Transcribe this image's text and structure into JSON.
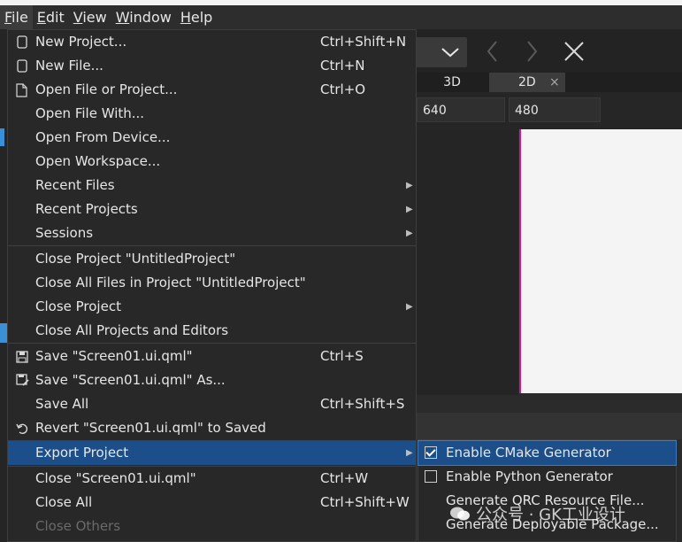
{
  "menubar": {
    "items": [
      {
        "label": "File",
        "underline": "F",
        "rest": "ile"
      },
      {
        "label": "Edit",
        "underline": "E",
        "rest": "dit"
      },
      {
        "label": "View",
        "underline": "V",
        "rest": "iew"
      },
      {
        "label": "Window",
        "underline": "W",
        "rest": "indow"
      },
      {
        "label": "Help",
        "underline": "H",
        "rest": "elp"
      }
    ]
  },
  "toolbar": {
    "tab_3d": "3D",
    "tab_2d": "2D",
    "tab_close": "×",
    "width_value": "640",
    "height_value": "480"
  },
  "file_menu": {
    "items": [
      {
        "label": "New Project...",
        "shortcut": "Ctrl+Shift+N",
        "icon": "new-project-icon"
      },
      {
        "label": "New File...",
        "shortcut": "Ctrl+N",
        "icon": "new-file-icon"
      },
      {
        "label": "Open File or Project...",
        "shortcut": "Ctrl+O",
        "icon": "open-file-icon"
      },
      {
        "label": "Open File With...",
        "shortcut": ""
      },
      {
        "label": "Open From Device...",
        "shortcut": ""
      },
      {
        "label": "Open Workspace...",
        "shortcut": ""
      },
      {
        "label": "Recent Files",
        "shortcut": "",
        "submenu": true
      },
      {
        "label": "Recent Projects",
        "shortcut": "",
        "submenu": true
      },
      {
        "label": "Sessions",
        "shortcut": "",
        "submenu": true
      },
      {
        "label": "Close Project \"UntitledProject\"",
        "shortcut": ""
      },
      {
        "label": "Close All Files in Project \"UntitledProject\"",
        "shortcut": ""
      },
      {
        "label": "Close Project",
        "shortcut": "",
        "submenu": true
      },
      {
        "label": "Close All Projects and Editors",
        "shortcut": ""
      },
      {
        "label": "Save \"Screen01.ui.qml\"",
        "shortcut": "Ctrl+S",
        "icon": "save-icon"
      },
      {
        "label": "Save \"Screen01.ui.qml\" As...",
        "shortcut": "",
        "icon": "save-as-icon"
      },
      {
        "label": "Save All",
        "shortcut": "Ctrl+Shift+S"
      },
      {
        "label": "Revert \"Screen01.ui.qml\" to Saved",
        "shortcut": "",
        "icon": "revert-icon"
      },
      {
        "label": "Export Project",
        "shortcut": "",
        "submenu": true,
        "selected": true
      },
      {
        "label": "Close \"Screen01.ui.qml\"",
        "shortcut": "Ctrl+W"
      },
      {
        "label": "Close All",
        "shortcut": "Ctrl+Shift+W"
      },
      {
        "label": "Close Others",
        "shortcut": "",
        "disabled": true
      }
    ]
  },
  "export_submenu": {
    "items": [
      {
        "label": "Enable CMake Generator",
        "checkbox": true,
        "checked": true,
        "selected": true
      },
      {
        "label": "Enable Python Generator",
        "checkbox": true,
        "checked": false
      },
      {
        "label": "Generate QRC Resource File..."
      },
      {
        "label": "Generate Deployable Package..."
      }
    ]
  },
  "watermark": {
    "text": "公众号 · GK工业设计"
  },
  "colors": {
    "selection": "#1c4f8a",
    "accent_magenta": "#d6148c",
    "menu_bg": "#282828"
  }
}
